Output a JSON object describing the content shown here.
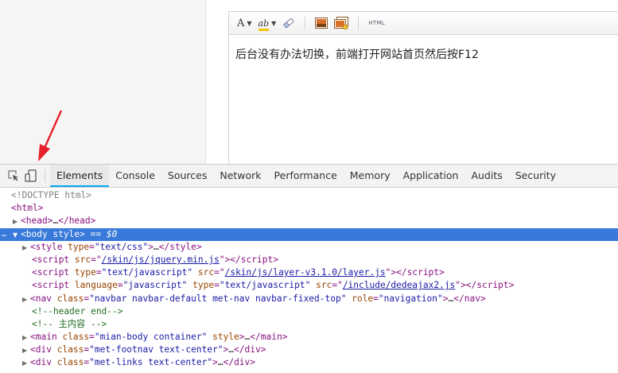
{
  "editor": {
    "toolbar": {
      "font_label": "A",
      "highlight_label": "ab",
      "html_label": "HTML"
    },
    "content": "后台没有办法切换，前端打开网站首页然后按F12"
  },
  "devtools": {
    "tabs": [
      {
        "label": "Elements",
        "active": true
      },
      {
        "label": "Console"
      },
      {
        "label": "Sources"
      },
      {
        "label": "Network"
      },
      {
        "label": "Performance"
      },
      {
        "label": "Memory"
      },
      {
        "label": "Application"
      },
      {
        "label": "Audits"
      },
      {
        "label": "Security"
      }
    ],
    "dom": {
      "doctype": "<!DOCTYPE html>",
      "html_open": "<html>",
      "head": {
        "tag": "head",
        "ellipsis": "…"
      },
      "body": {
        "tag": "body",
        "attr": "style",
        "suffix": "== $0"
      },
      "style_line": {
        "tag": "style",
        "attr": "type",
        "value": "\"text/css\"",
        "ellipsis": "…"
      },
      "script1": {
        "tag": "script",
        "attr": "src",
        "value": "/skin/js/jquery.min.js"
      },
      "script2": {
        "tag": "script",
        "attr1": "type",
        "value1": "\"text/javascript\"",
        "attr2": "src",
        "value2": "/skin/js/layer-v3.1.0/layer.js"
      },
      "script3": {
        "tag": "script",
        "attr1": "language",
        "value1": "\"javascript\"",
        "attr2": "type",
        "value2": "\"text/javascript\"",
        "attr3": "src",
        "value3": "/include/dedeajax2.js"
      },
      "nav": {
        "tag": "nav",
        "attr1": "class",
        "value1": "\"navbar navbar-default met-nav navbar-fixed-top\"",
        "attr2": "role",
        "value2": "\"navigation\"",
        "ellipsis": "…"
      },
      "comment1": "<!--header end-->",
      "comment2": "<!-- 主内容 -->",
      "main": {
        "tag": "main",
        "attr1": "class",
        "value1": "\"mian-body container\"",
        "attr2": "style",
        "ellipsis": "…"
      },
      "div1": {
        "tag": "div",
        "attr": "class",
        "value": "\"met-footnav text-center\"",
        "ellipsis": "…"
      },
      "div2": {
        "tag": "div",
        "attr": "class",
        "value": "\"met-links text-center\"",
        "ellipsis": "…"
      }
    }
  },
  "colors": {
    "selection": "#3879d9",
    "tab_underline": "#03a9f4",
    "arrow": "#e8202a"
  }
}
